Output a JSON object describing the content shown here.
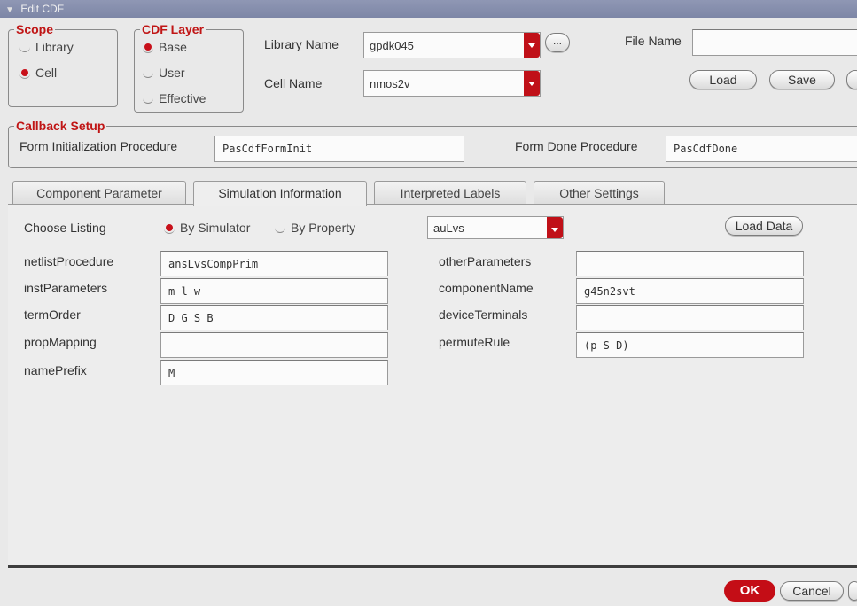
{
  "window": {
    "title": "Edit CDF"
  },
  "scope": {
    "legend": "Scope",
    "options": [
      {
        "label": "Library",
        "selected": false
      },
      {
        "label": "Cell",
        "selected": true
      }
    ]
  },
  "cdf_layer": {
    "legend": "CDF Layer",
    "options": [
      {
        "label": "Base",
        "selected": true
      },
      {
        "label": "User",
        "selected": false
      },
      {
        "label": "Effective",
        "selected": false
      }
    ]
  },
  "header": {
    "library_name_label": "Library Name",
    "library_name_value": "gpdk045",
    "browse_label": "...",
    "cell_name_label": "Cell Name",
    "cell_name_value": "nmos2v",
    "file_name_label": "File Name",
    "file_name_value": "",
    "load_label": "Load",
    "save_label": "Save"
  },
  "callback": {
    "legend": "Callback Setup",
    "init_label": "Form Initialization Procedure",
    "init_value": "PasCdfFormInit",
    "done_label": "Form Done Procedure",
    "done_value": "PasCdfDone"
  },
  "tabs": [
    {
      "label": "Component Parameter",
      "active": false
    },
    {
      "label": "Simulation Information",
      "active": true
    },
    {
      "label": "Interpreted Labels",
      "active": false
    },
    {
      "label": "Other Settings",
      "active": false
    }
  ],
  "sim": {
    "choose_listing_label": "Choose Listing",
    "by_simulator_label": "By Simulator",
    "by_property_label": "By Property",
    "listing_selected": "By Simulator",
    "simulator_value": "auLvs",
    "load_data_label": "Load Data",
    "left_fields": [
      {
        "label": "netlistProcedure",
        "value": "ansLvsCompPrim"
      },
      {
        "label": "instParameters",
        "value": "m l w"
      },
      {
        "label": "termOrder",
        "value": "D G S B"
      },
      {
        "label": "propMapping",
        "value": ""
      },
      {
        "label": "namePrefix",
        "value": "M"
      }
    ],
    "right_fields": [
      {
        "label": "otherParameters",
        "value": ""
      },
      {
        "label": "componentName",
        "value": "g45n2svt"
      },
      {
        "label": "deviceTerminals",
        "value": ""
      },
      {
        "label": "permuteRule",
        "value": "(p S D)"
      }
    ]
  },
  "footer": {
    "ok_label": "OK",
    "cancel_label": "Cancel"
  },
  "colors": {
    "accent": "#c40d16",
    "titlebar": "#8a92b0",
    "background": "#e9e9e9"
  }
}
